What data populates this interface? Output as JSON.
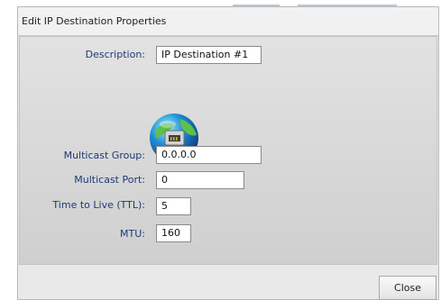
{
  "dialog": {
    "title": "Edit IP Destination Properties",
    "close_label": "Close"
  },
  "fields": {
    "description": {
      "label": "Description:",
      "value": "IP Destination #1"
    },
    "multicast_group": {
      "label": "Multicast Group:",
      "value": "0.0.0.0"
    },
    "multicast_port": {
      "label": "Multicast Port:",
      "value": "0"
    },
    "ttl": {
      "label": "Time to Live (TTL):",
      "value": "5"
    },
    "mtu": {
      "label": "MTU:",
      "value": "160"
    }
  },
  "icons": {
    "destination": "network-globe-icon"
  },
  "colors": {
    "label_text": "#1e3a78",
    "dialog_bg": "#dcdcdc"
  }
}
